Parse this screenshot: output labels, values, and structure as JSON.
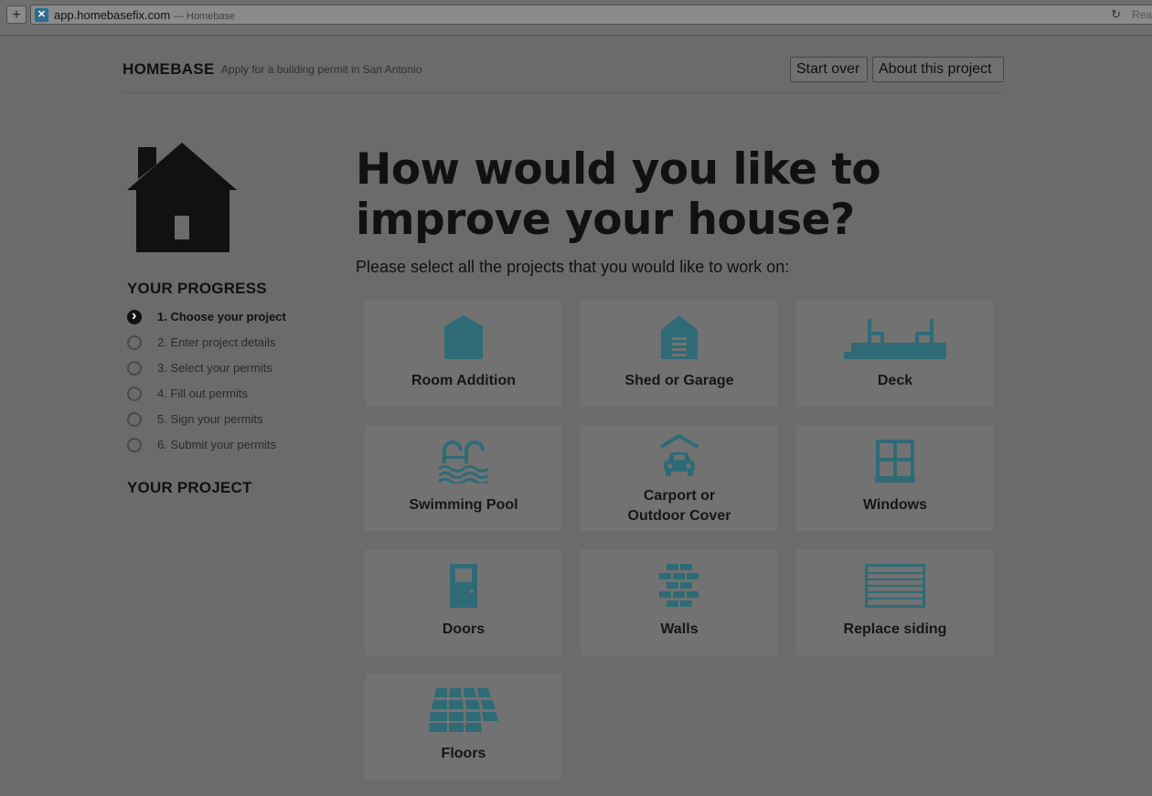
{
  "browser": {
    "domain": "app.homebasefix.com",
    "page_title": "— Homebase",
    "reader_label": "Rea"
  },
  "header": {
    "brand": "HOMEBASE",
    "tagline": "Apply for a building permit in San Antonio",
    "start_over": "Start over",
    "about": "About this project"
  },
  "sidebar": {
    "progress_title": "YOUR PROGRESS",
    "project_title": "YOUR PROJECT",
    "steps": [
      {
        "label": "1. Choose your project",
        "active": true
      },
      {
        "label": "2. Enter project details",
        "active": false
      },
      {
        "label": "3. Select your permits",
        "active": false
      },
      {
        "label": "4. Fill out permits",
        "active": false
      },
      {
        "label": "5. Sign your permits",
        "active": false
      },
      {
        "label": "6. Submit your permits",
        "active": false
      }
    ]
  },
  "main": {
    "heading": "How would you like to improve your house?",
    "subheading": "Please select all the projects that you would like to work on:",
    "projects": [
      {
        "label": "Room Addition",
        "icon": "room-addition-icon"
      },
      {
        "label": "Shed or Garage",
        "icon": "shed-garage-icon"
      },
      {
        "label": "Deck",
        "icon": "deck-icon"
      },
      {
        "label": "Swimming Pool",
        "icon": "swimming-pool-icon"
      },
      {
        "label_line1": "Carport or",
        "label_line2": "Outdoor Cover",
        "icon": "carport-icon"
      },
      {
        "label": "Windows",
        "icon": "windows-icon"
      },
      {
        "label": "Doors",
        "icon": "door-icon"
      },
      {
        "label": "Walls",
        "icon": "walls-icon"
      },
      {
        "label": "Replace siding",
        "icon": "siding-icon"
      },
      {
        "label": "Floors",
        "icon": "floors-icon"
      }
    ]
  },
  "colors": {
    "icon_teal": "#2f6b76",
    "overlay_bg": "#6b6b6b",
    "tile_bg": "#727272"
  }
}
